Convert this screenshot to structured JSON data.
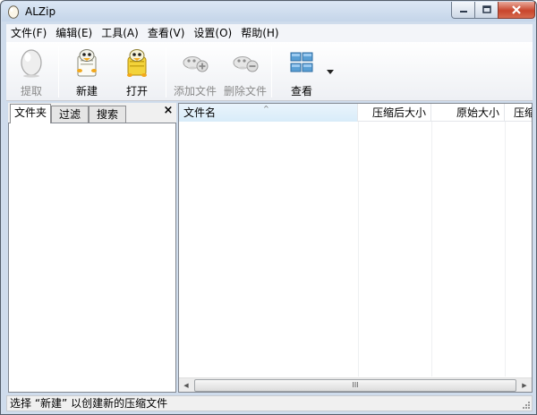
{
  "window": {
    "title": "ALZip"
  },
  "menu": [
    "文件(F)",
    "编辑(E)",
    "工具(A)",
    "查看(V)",
    "设置(O)",
    "帮助(H)"
  ],
  "toolbar": {
    "extract": {
      "label": "提取",
      "enabled": false,
      "icon": "egg-icon"
    },
    "new": {
      "label": "新建",
      "enabled": true,
      "icon": "new-archive-icon"
    },
    "open": {
      "label": "打开",
      "enabled": true,
      "icon": "open-archive-icon"
    },
    "add_file": {
      "label": "添加文件",
      "enabled": false,
      "icon": "add-file-icon"
    },
    "delete_file": {
      "label": "删除文件",
      "enabled": false,
      "icon": "delete-file-icon"
    },
    "view": {
      "label": "查看",
      "enabled": true,
      "icon": "view-grid-icon"
    }
  },
  "left_panel": {
    "tabs": [
      "文件夹",
      "过滤",
      "搜索"
    ],
    "active_tab": 0,
    "close_glyph": "×"
  },
  "list": {
    "columns": [
      "文件名",
      "压缩后大小",
      "原始大小",
      "压缩"
    ],
    "sort_glyph": "^"
  },
  "scrollbar": {
    "grip": "III",
    "left_arrow": "◀",
    "right_arrow": "▶"
  },
  "status": {
    "text": "选择 “新建” 以创建新的压缩文件"
  },
  "colors": {
    "chrome": "#cfdcec",
    "accent": "#3c7fb1",
    "close_button": "#c8452c"
  }
}
